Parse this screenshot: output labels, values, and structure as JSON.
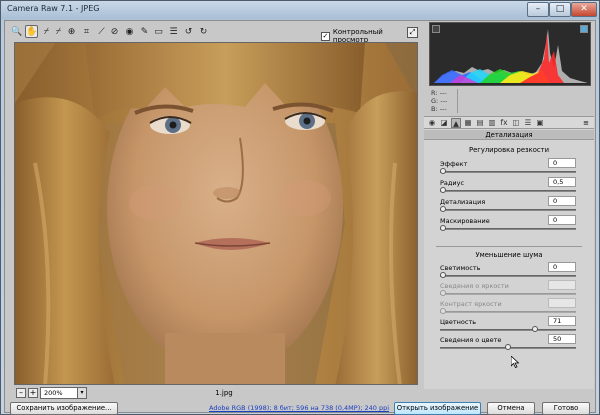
{
  "window": {
    "title": "Camera Raw 7.1  -  JPEG",
    "minimize_glyph": "–",
    "maximize_glyph": "□",
    "close_glyph": "✕"
  },
  "toolbar": {
    "tools": [
      {
        "name": "zoom-tool-icon",
        "glyph": "🔍"
      },
      {
        "name": "hand-tool-icon",
        "glyph": "✋"
      },
      {
        "name": "white-balance-tool-icon",
        "glyph": "⌿"
      },
      {
        "name": "color-sampler-tool-icon",
        "glyph": "⌿"
      },
      {
        "name": "targeted-adjustment-tool-icon",
        "glyph": "⊕"
      },
      {
        "name": "crop-tool-icon",
        "glyph": "⌗"
      },
      {
        "name": "straighten-tool-icon",
        "glyph": "⟋"
      },
      {
        "name": "spot-removal-tool-icon",
        "glyph": "⊘"
      },
      {
        "name": "red-eye-tool-icon",
        "glyph": "◉"
      },
      {
        "name": "adjustment-brush-icon",
        "glyph": "✎"
      },
      {
        "name": "graduated-filter-icon",
        "glyph": "▭"
      },
      {
        "name": "preferences-icon",
        "glyph": "☰"
      },
      {
        "name": "rotate-ccw-icon",
        "glyph": "↺"
      },
      {
        "name": "rotate-cw-icon",
        "glyph": "↻"
      }
    ],
    "preview_label": "Контрольный просмотр",
    "preview_checked": "✓"
  },
  "zoom": {
    "minus": "–",
    "plus": "+",
    "level": "200%",
    "arrow": "▾"
  },
  "file": {
    "name": "1.jpg"
  },
  "readout": {
    "r": "R: ---",
    "g": "G: ---",
    "b": "B: ---"
  },
  "panel": {
    "title": "Детализация",
    "tabs": [
      {
        "name": "tab-basic-icon",
        "glyph": "◉"
      },
      {
        "name": "tab-tone-curve-icon",
        "glyph": "◪"
      },
      {
        "name": "tab-detail-icon",
        "glyph": "▲"
      },
      {
        "name": "tab-hsl-icon",
        "glyph": "▦"
      },
      {
        "name": "tab-split-toning-icon",
        "glyph": "▤"
      },
      {
        "name": "tab-lens-icon",
        "glyph": "▥"
      },
      {
        "name": "tab-effects-icon",
        "glyph": "fx"
      },
      {
        "name": "tab-camera-calibration-icon",
        "glyph": "◫"
      },
      {
        "name": "tab-presets-icon",
        "glyph": "☰"
      },
      {
        "name": "tab-snapshots-icon",
        "glyph": "▣"
      }
    ],
    "menu_glyph": "≡",
    "sharpening": {
      "title": "Регулировка резкости",
      "rows": [
        {
          "label": "Эффект",
          "value": "0",
          "level": 0.0
        },
        {
          "label": "Радиус",
          "value": "0,5",
          "level": 0.0
        },
        {
          "label": "Детализация",
          "value": "0",
          "level": 0.0
        },
        {
          "label": "Маскирование",
          "value": "0",
          "level": 0.0
        }
      ]
    },
    "noise": {
      "title": "Уменьшение шума",
      "rows": [
        {
          "label": "Светимость",
          "value": "0",
          "level": 0.0,
          "disabled": false
        },
        {
          "label": "Сведения о яркости",
          "value": "",
          "level": 0.0,
          "disabled": true
        },
        {
          "label": "Контраст яркости",
          "value": "",
          "level": 0.0,
          "disabled": true
        },
        {
          "label": "Цветность",
          "value": "71",
          "level": 0.71,
          "disabled": false
        },
        {
          "label": "Сведения о цвете",
          "value": "50",
          "level": 0.5,
          "disabled": false
        }
      ]
    }
  },
  "footer": {
    "save_label": "Сохранить изображение...",
    "info_link": "Adobe RGB (1998); 8 бит; 596 на 738 (0,4МР); 240 ppi",
    "open_label": "Открыть изображение",
    "cancel_label": "Отмена",
    "done_label": "Готово"
  },
  "colors": {
    "hair": "#b88a48",
    "skin": "#c89a6a",
    "primary_button": "#bee6fd",
    "link": "#1a3fbf"
  }
}
